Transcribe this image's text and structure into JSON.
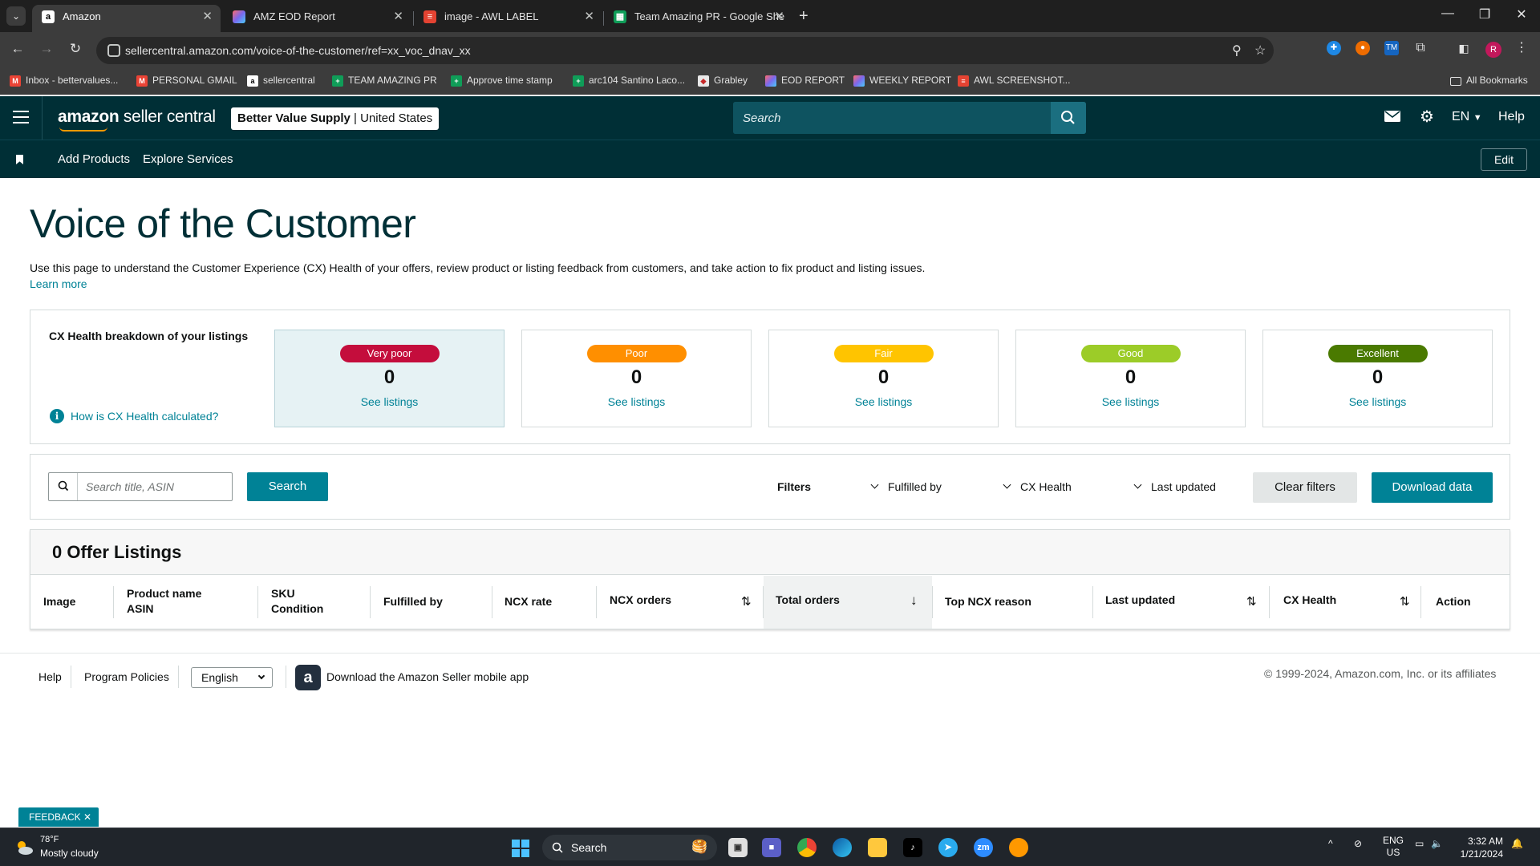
{
  "browser": {
    "tabs": [
      {
        "label": "Amazon",
        "icon": "amazon-icon",
        "active": true
      },
      {
        "label": "AMZ EOD Report",
        "icon": "clickup-icon"
      },
      {
        "label": "image - AWL LABEL",
        "icon": "todoist-icon"
      },
      {
        "label": "Team Amazing PR - Google She",
        "icon": "sheets-icon"
      }
    ],
    "url": "sellercentral.amazon.com/voice-of-the-customer/ref=xx_voc_dnav_xx",
    "profile_initial": "R",
    "bookmarks": [
      {
        "label": "Inbox - bettervalues...",
        "icon": "gmail-icon"
      },
      {
        "label": "PERSONAL GMAIL",
        "icon": "gmail-icon"
      },
      {
        "label": "sellercentral",
        "icon": "amazon-icon"
      },
      {
        "label": "TEAM AMAZING PR",
        "icon": "sheets-icon"
      },
      {
        "label": "Approve time stamp",
        "icon": "sheets-icon"
      },
      {
        "label": "arc104 Santino Laco...",
        "icon": "sheets-icon"
      },
      {
        "label": "Grabley",
        "icon": "grabley-icon"
      },
      {
        "label": "EOD REPORT",
        "icon": "clickup-icon"
      },
      {
        "label": "WEEKLY REPORT",
        "icon": "clickup-icon"
      },
      {
        "label": "AWL SCREENSHOT...",
        "icon": "todoist-icon"
      }
    ],
    "all_bookmarks": "All Bookmarks"
  },
  "header": {
    "logo_amazon": "amazon",
    "logo_rest": " seller central",
    "store_name": "Better Value Supply",
    "store_sep": " | ",
    "store_region": "United States",
    "search_placeholder": "Search",
    "language": "EN",
    "help": "Help"
  },
  "subnav": {
    "links": [
      "Add Products",
      "Explore Services"
    ],
    "edit": "Edit"
  },
  "page": {
    "title": "Voice of the Customer",
    "description": "Use this page to understand the Customer Experience (CX) Health of your offers, review product or listing feedback from customers, and take action to fix product and listing issues.",
    "learn_more": "Learn more"
  },
  "cx_health": {
    "heading": "CX Health breakdown of your listings",
    "help_link": "How is CX Health calculated?",
    "cards": [
      {
        "label": "Very poor",
        "count": "0",
        "link": "See listings",
        "color": "#c40d3c",
        "selected": true
      },
      {
        "label": "Poor",
        "count": "0",
        "link": "See listings",
        "color": "#ff8f00"
      },
      {
        "label": "Fair",
        "count": "0",
        "link": "See listings",
        "color": "#ffc400"
      },
      {
        "label": "Good",
        "count": "0",
        "link": "See listings",
        "color": "#9ccc28"
      },
      {
        "label": "Excellent",
        "count": "0",
        "link": "See listings",
        "color": "#4a7a00"
      }
    ]
  },
  "filters": {
    "search_placeholder": "Search title, ASIN",
    "search_button": "Search",
    "label": "Filters",
    "dropdowns": [
      "Fulfilled by",
      "CX Health",
      "Last updated"
    ],
    "clear": "Clear filters",
    "download": "Download data"
  },
  "listings": {
    "title": "0 Offer Listings",
    "columns": [
      {
        "line1": "Image",
        "line2": ""
      },
      {
        "line1": "Product name",
        "line2": "ASIN"
      },
      {
        "line1": "SKU",
        "line2": "Condition"
      },
      {
        "line1": "Fulfilled by",
        "line2": ""
      },
      {
        "line1": "NCX rate",
        "line2": ""
      },
      {
        "line1": "NCX orders",
        "line2": ""
      },
      {
        "line1": "Total orders",
        "line2": ""
      },
      {
        "line1": "Top NCX reason",
        "line2": ""
      },
      {
        "line1": "Last updated",
        "line2": ""
      },
      {
        "line1": "CX Health",
        "line2": ""
      },
      {
        "line1": "Action",
        "line2": ""
      }
    ]
  },
  "footer": {
    "links": [
      "Help",
      "Program Policies"
    ],
    "language": "English",
    "app_text": "Download the Amazon Seller mobile app",
    "copyright": "© 1999-2024, Amazon.com, Inc. or its affiliates"
  },
  "feedback": "FEEDBACK",
  "taskbar": {
    "weather_temp": "78°F",
    "weather_desc": "Mostly cloudy",
    "search": "Search",
    "lang_top": "ENG",
    "lang_bottom": "US",
    "time": "3:32 AM",
    "date": "1/21/2024"
  },
  "colors": {
    "header_bg": "#002f36",
    "accent": "#008296"
  }
}
